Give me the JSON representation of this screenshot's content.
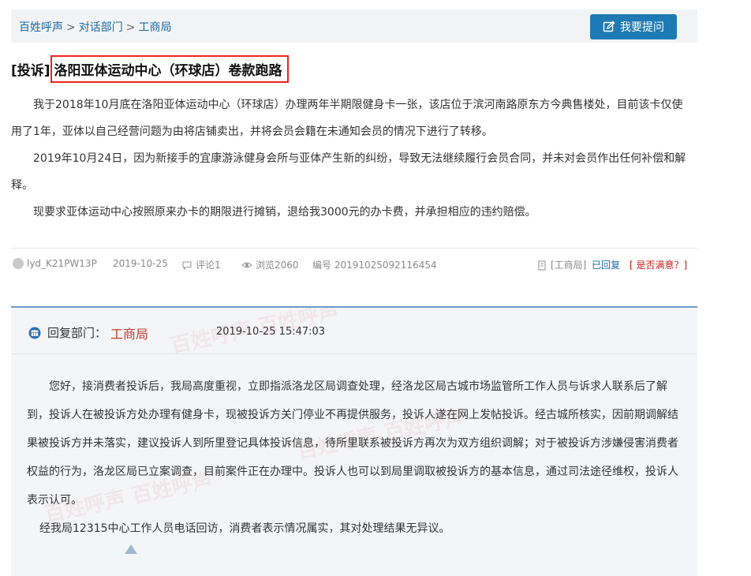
{
  "breadcrumb": {
    "items": [
      "百姓呼声",
      "对话部门",
      "工商局"
    ],
    "separator": ">"
  },
  "ask_button": {
    "label": "我要提问"
  },
  "post": {
    "tag": "[投诉]",
    "title": "洛阳亚体运动中心（环球店）卷款跑路",
    "paragraphs": [
      "我于2018年10月底在洛阳亚体运动中心（环球店）办理两年半期限健身卡一张，该店位于滨河南路原东方今典售楼处，目前该卡仅使用了1年，亚体以自己经营问题为由将店铺卖出，并将会员会籍在未通知会员的情况下进行了转移。",
      "2019年10月24日，因为新接手的宜康游泳健身会所与亚体产生新的纠纷，导致无法继续履行会员合同，并未对会员作出任何补偿和解释。",
      "现要求亚体运动中心按照原来办卡的期限进行摊销，退给我3000元的办卡费，并承担相应的违约赔偿。"
    ],
    "meta": {
      "user": "lyd_K21PW13P",
      "date": "2019-10-25",
      "comments": "评论1",
      "views": "浏览2060",
      "number": "编号 20191025092116454",
      "dept": "[工商局]",
      "status": "已回复",
      "satisfaction": "[ 是否满意？]"
    }
  },
  "reply": {
    "label": "回复部门：",
    "dept": "工商局",
    "time": "2019-10-25 15:47:03",
    "paragraphs": [
      "您好，接消费者投诉后，我局高度重视，立即指派洛龙区局调查处理，经洛龙区局古城市场监管所工作人员与诉求人联系后了解到，投诉人在被投诉方处办理有健身卡，现被投诉方关门停业不再提供服务，投诉人遂在网上发帖投诉。经古城所核实，因前期调解结果被投诉方并未落实，建议投诉人到所里登记具体投诉信息，待所里联系被投诉方再次为双方组织调解；对于被投诉方涉嫌侵害消费者权益的行为，洛龙区局已立案调查，目前案件正在办理中。投诉人也可以到局里调取被投诉方的基本信息，通过司法途径维权，投诉人表示认可。",
      "经我局12315中心工作人员电话回访，消费者表示情况属实，其对处理结果无异议。"
    ]
  },
  "colors": {
    "accent": "#1e7ab4",
    "link": "#1c6aa4",
    "highlight_border": "#e22222",
    "dept_red": "#c03a2b"
  }
}
